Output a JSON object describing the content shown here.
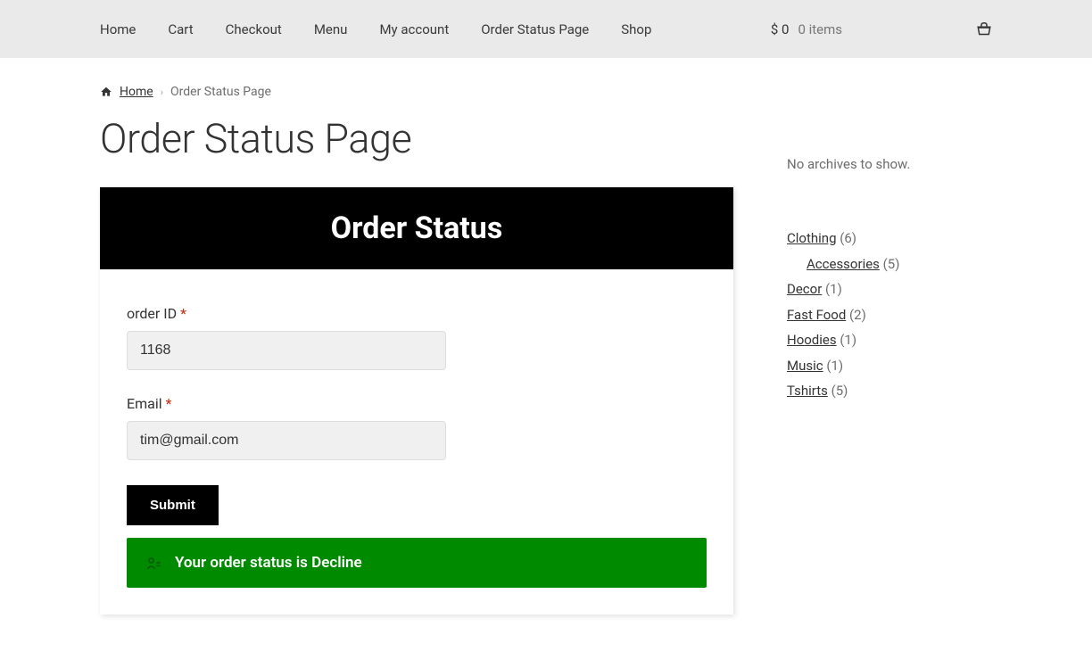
{
  "nav": {
    "items": [
      "Home",
      "Cart",
      "Checkout",
      "Menu",
      "My account",
      "Order Status Page",
      "Shop"
    ]
  },
  "cart": {
    "currency": "$",
    "amount": "0",
    "items_label": "0 items"
  },
  "breadcrumb": {
    "home": "Home",
    "current": "Order Status Page"
  },
  "page": {
    "title": "Order Status Page"
  },
  "form": {
    "header": "Order Status",
    "order_id_label": "order ID",
    "order_id_value": "1168",
    "email_label": "Email",
    "email_value": "tim@gmail.com",
    "submit_label": "Submit",
    "required_mark": "*"
  },
  "status": {
    "message": "Your order status is Decline"
  },
  "sidebar": {
    "archives_text": "No archives to show.",
    "categories": [
      {
        "name": "Clothing",
        "count": "(6)",
        "sub": [
          {
            "name": "Accessories",
            "count": "(5)"
          }
        ]
      },
      {
        "name": "Decor",
        "count": "(1)"
      },
      {
        "name": "Fast Food",
        "count": "(2)"
      },
      {
        "name": "Hoodies",
        "count": "(1)"
      },
      {
        "name": "Music",
        "count": "(1)"
      },
      {
        "name": "Tshirts",
        "count": "(5)"
      }
    ]
  }
}
